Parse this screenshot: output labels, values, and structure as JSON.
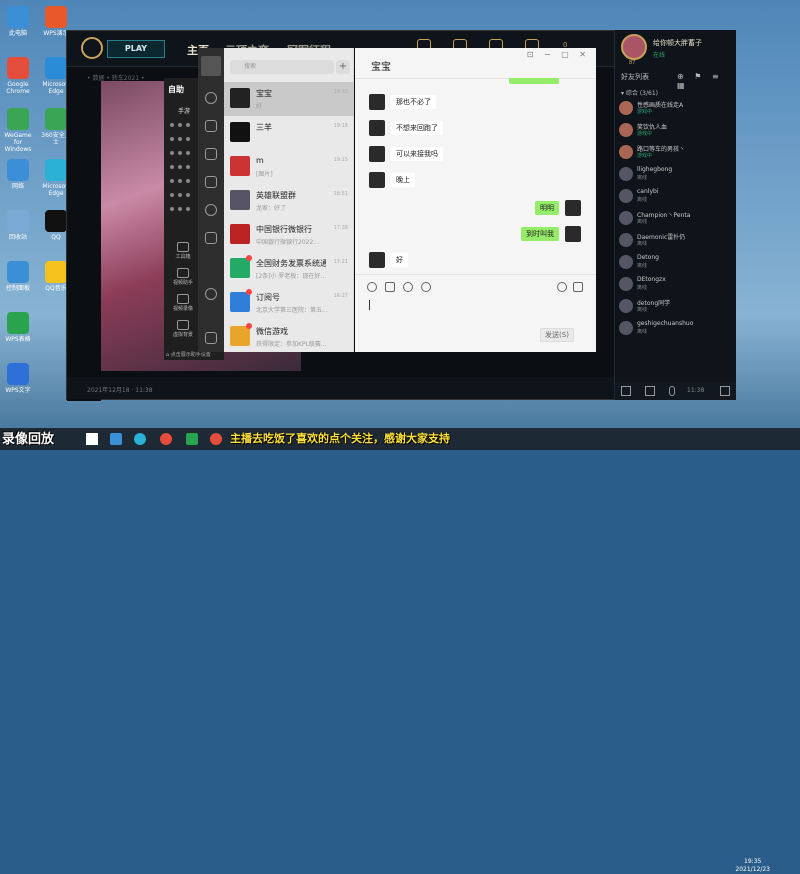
{
  "desktop": {
    "icons": [
      {
        "label": "此电脑",
        "color": "#3a8fd6"
      },
      {
        "label": "Google Chrome",
        "color": "#e44c3c"
      },
      {
        "label": "WeGame for Windows",
        "color": "#3aa655"
      },
      {
        "label": "网络",
        "color": "#3a8fd6"
      },
      {
        "label": "回收站",
        "color": "#7aa9d6"
      },
      {
        "label": "控制面板",
        "color": "#3a8fd6"
      },
      {
        "label": "WPS表格",
        "color": "#2aa34f"
      },
      {
        "label": "WPS文字",
        "color": "#2f6fd8"
      }
    ],
    "icons_col2": [
      {
        "label": "WPS演示",
        "color": "#e8582b"
      },
      {
        "label": "Microsoft Edge",
        "color": "#2a8bd6"
      },
      {
        "label": "360安全卫士",
        "color": "#3aa655"
      },
      {
        "label": "Microsoft Edge",
        "color": "#2bb0d6"
      },
      {
        "label": "QQ",
        "color": "#111"
      },
      {
        "label": "QQ音乐",
        "color": "#f4c21c"
      }
    ]
  },
  "lol": {
    "play_label": "PLAY",
    "tabs": [
      "主页",
      "云顶之弈",
      "冠军征程"
    ],
    "sub_nav": "• 数据  • 转车2021 •",
    "rp_amount": "0",
    "bottom_left": "2021年12月18 · 11:38"
  },
  "friends": {
    "player_name": "给你顿大胖蓄子",
    "player_status": "在线",
    "level": "87",
    "title": "好友列表",
    "group_label": "▾ 综合 (3/61)",
    "items": [
      {
        "name": "性感画质在线走A",
        "status": "游戏中",
        "online": true
      },
      {
        "name": "笑饮仇人血",
        "status": "游戏中",
        "online": true
      },
      {
        "name": "路口等车的男孩丶",
        "status": "游戏中",
        "online": true
      },
      {
        "name": "llighegbong",
        "status": "离线",
        "online": false
      },
      {
        "name": "canlybi",
        "status": "离线",
        "online": false
      },
      {
        "name": "Champion丶Penta",
        "status": "离线",
        "online": false
      },
      {
        "name": "Daemonic雷扑仍",
        "status": "离线",
        "online": false
      },
      {
        "name": "Detong",
        "status": "离线",
        "online": false
      },
      {
        "name": "DEtongzx",
        "status": "离线",
        "online": false
      },
      {
        "name": "detong同学",
        "status": "离线",
        "online": false
      },
      {
        "name": "geshigechuanshuo",
        "status": "离线",
        "online": false
      }
    ],
    "bottom_time": "11:38"
  },
  "assistant": {
    "logo": "自助",
    "tab_label": "手游",
    "menus": [
      "工具箱",
      "视频助手",
      "视频录像",
      "虚拟背景"
    ],
    "footer": "⌂ 点击展示助手设置"
  },
  "wechat": {
    "search_placeholder": "搜索",
    "plus": "+",
    "conversations": [
      {
        "title": "宝宝",
        "preview": "好",
        "time": "19:33",
        "avatar": "#222",
        "badge": false
      },
      {
        "title": "三羊",
        "preview": "",
        "time": "19:16",
        "avatar": "#111",
        "badge": false
      },
      {
        "title": "m",
        "preview": "[图片]",
        "time": "19:15",
        "avatar": "#c33",
        "badge": false
      },
      {
        "title": "英雄联盟群",
        "preview": "龙家：好了",
        "time": "18:51",
        "avatar": "#556",
        "badge": false
      },
      {
        "title": "中国银行微银行",
        "preview": "中国银行微银行2022...",
        "time": "17:38",
        "avatar": "#b22",
        "badge": false
      },
      {
        "title": "全国财务发票系统通...",
        "preview": "[2条]小 罗老板：现在好...",
        "time": "17:21",
        "avatar": "#2a6",
        "badge": true
      },
      {
        "title": "订阅号",
        "preview": "北京大学第三医院：第五...",
        "time": "16:27",
        "avatar": "#2f7fd8",
        "badge": true
      },
      {
        "title": "微信游戏",
        "preview": "获得限定：参加KPL联赛...",
        "time": "",
        "avatar": "#e9a52a",
        "badge": true
      }
    ],
    "chat_title": "宝宝",
    "window_buttons": "⊡ − ▢ ✕",
    "messages": [
      {
        "dir": "in",
        "text": "那也不必了"
      },
      {
        "dir": "in",
        "text": "不想来回跑了"
      },
      {
        "dir": "in",
        "text": "可以来接我吗"
      },
      {
        "dir": "in",
        "text": "晚上"
      },
      {
        "dir": "out",
        "text": "明明"
      },
      {
        "dir": "out",
        "text": "到时叫我"
      },
      {
        "dir": "in",
        "text": "好"
      }
    ],
    "send_label": "发送(S)"
  },
  "overlay": {
    "replay": "录像回放",
    "marquee": "主播去吃饭了喜欢的点个关注，感谢大家支持"
  },
  "taskbar": {
    "time": "19:35",
    "date": "2021/12/23"
  }
}
